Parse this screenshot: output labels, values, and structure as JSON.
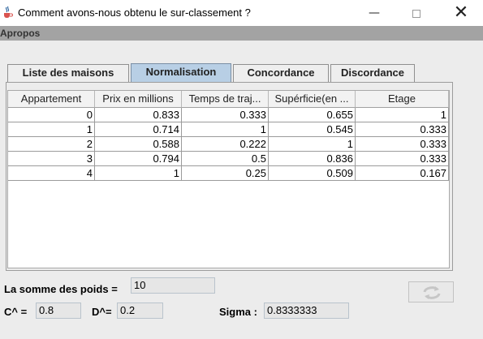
{
  "window": {
    "title": "Comment avons-nous obtenu le sur-classement ?",
    "minimize": "—",
    "close": "✕"
  },
  "menubar": {
    "item": "Apropos"
  },
  "tabs": [
    {
      "label": "Liste des maisons",
      "selected": false
    },
    {
      "label": "Normalisation",
      "selected": true
    },
    {
      "label": "Concordance",
      "selected": false
    },
    {
      "label": "Discordance",
      "selected": false
    }
  ],
  "table": {
    "columns": [
      "Appartement",
      "Prix en millions",
      "Temps de traj...",
      "Supérficie(en ...",
      "Etage"
    ],
    "rows": [
      [
        "0",
        "0.833",
        "0.333",
        "0.655",
        "1"
      ],
      [
        "1",
        "0.714",
        "1",
        "0.545",
        "0.333"
      ],
      [
        "2",
        "0.588",
        "0.222",
        "1",
        "0.333"
      ],
      [
        "3",
        "0.794",
        "0.5",
        "0.836",
        "0.333"
      ],
      [
        "4",
        "1",
        "0.25",
        "0.509",
        "0.167"
      ]
    ]
  },
  "form": {
    "somme_label": "La somme des poids =",
    "somme_value": "10",
    "cplus_label": "C^ =",
    "cplus_value": "0.8",
    "dplus_label": "D^=",
    "dplus_value": "0.2",
    "sigma_label": "Sigma :",
    "sigma_value": "0.8333333"
  },
  "icons": {
    "app": "java-cup-icon",
    "refresh": "refresh-icon"
  },
  "colors": {
    "selected_tab": "#b8cfe5",
    "menubar": "#a3a3a3"
  }
}
